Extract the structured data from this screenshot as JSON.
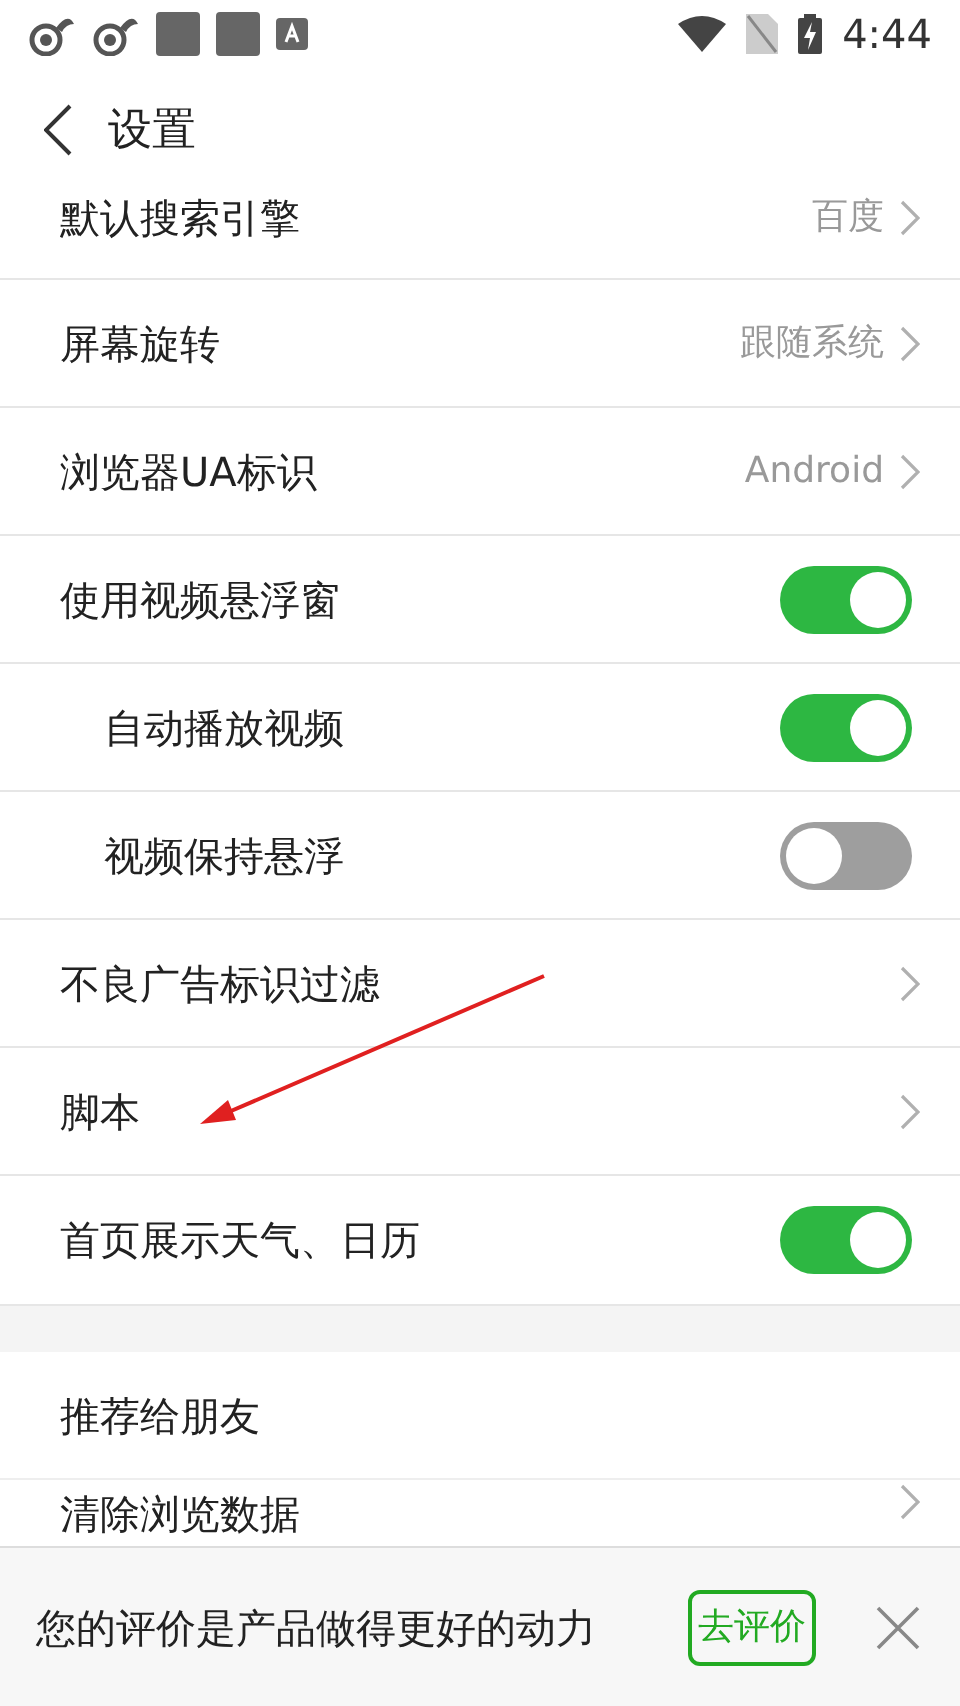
{
  "status_bar": {
    "time": "4:44"
  },
  "header": {
    "title": "设置"
  },
  "settings": [
    {
      "kind": "link",
      "label": "默认搜索引擎",
      "value": "百度",
      "indented": false
    },
    {
      "kind": "link",
      "label": "屏幕旋转",
      "value": "跟随系统",
      "indented": false
    },
    {
      "kind": "link",
      "label": "浏览器UA标识",
      "value": "Android",
      "indented": false
    },
    {
      "kind": "toggle",
      "label": "使用视频悬浮窗",
      "on": true,
      "indented": false
    },
    {
      "kind": "toggle",
      "label": "自动播放视频",
      "on": true,
      "indented": true
    },
    {
      "kind": "toggle",
      "label": "视频保持悬浮",
      "on": false,
      "indented": true
    },
    {
      "kind": "link",
      "label": "不良广告标识过滤",
      "indented": false
    },
    {
      "kind": "link",
      "label": "脚本",
      "indented": false
    },
    {
      "kind": "toggle",
      "label": "首页展示天气、日历",
      "on": true,
      "indented": false
    }
  ],
  "more": [
    {
      "kind": "plain",
      "label": "推荐给朋友"
    },
    {
      "kind": "link",
      "label": "清除浏览数据"
    }
  ],
  "rating_banner": {
    "message": "您的评价是产品做得更好的动力",
    "button": "去评价"
  }
}
